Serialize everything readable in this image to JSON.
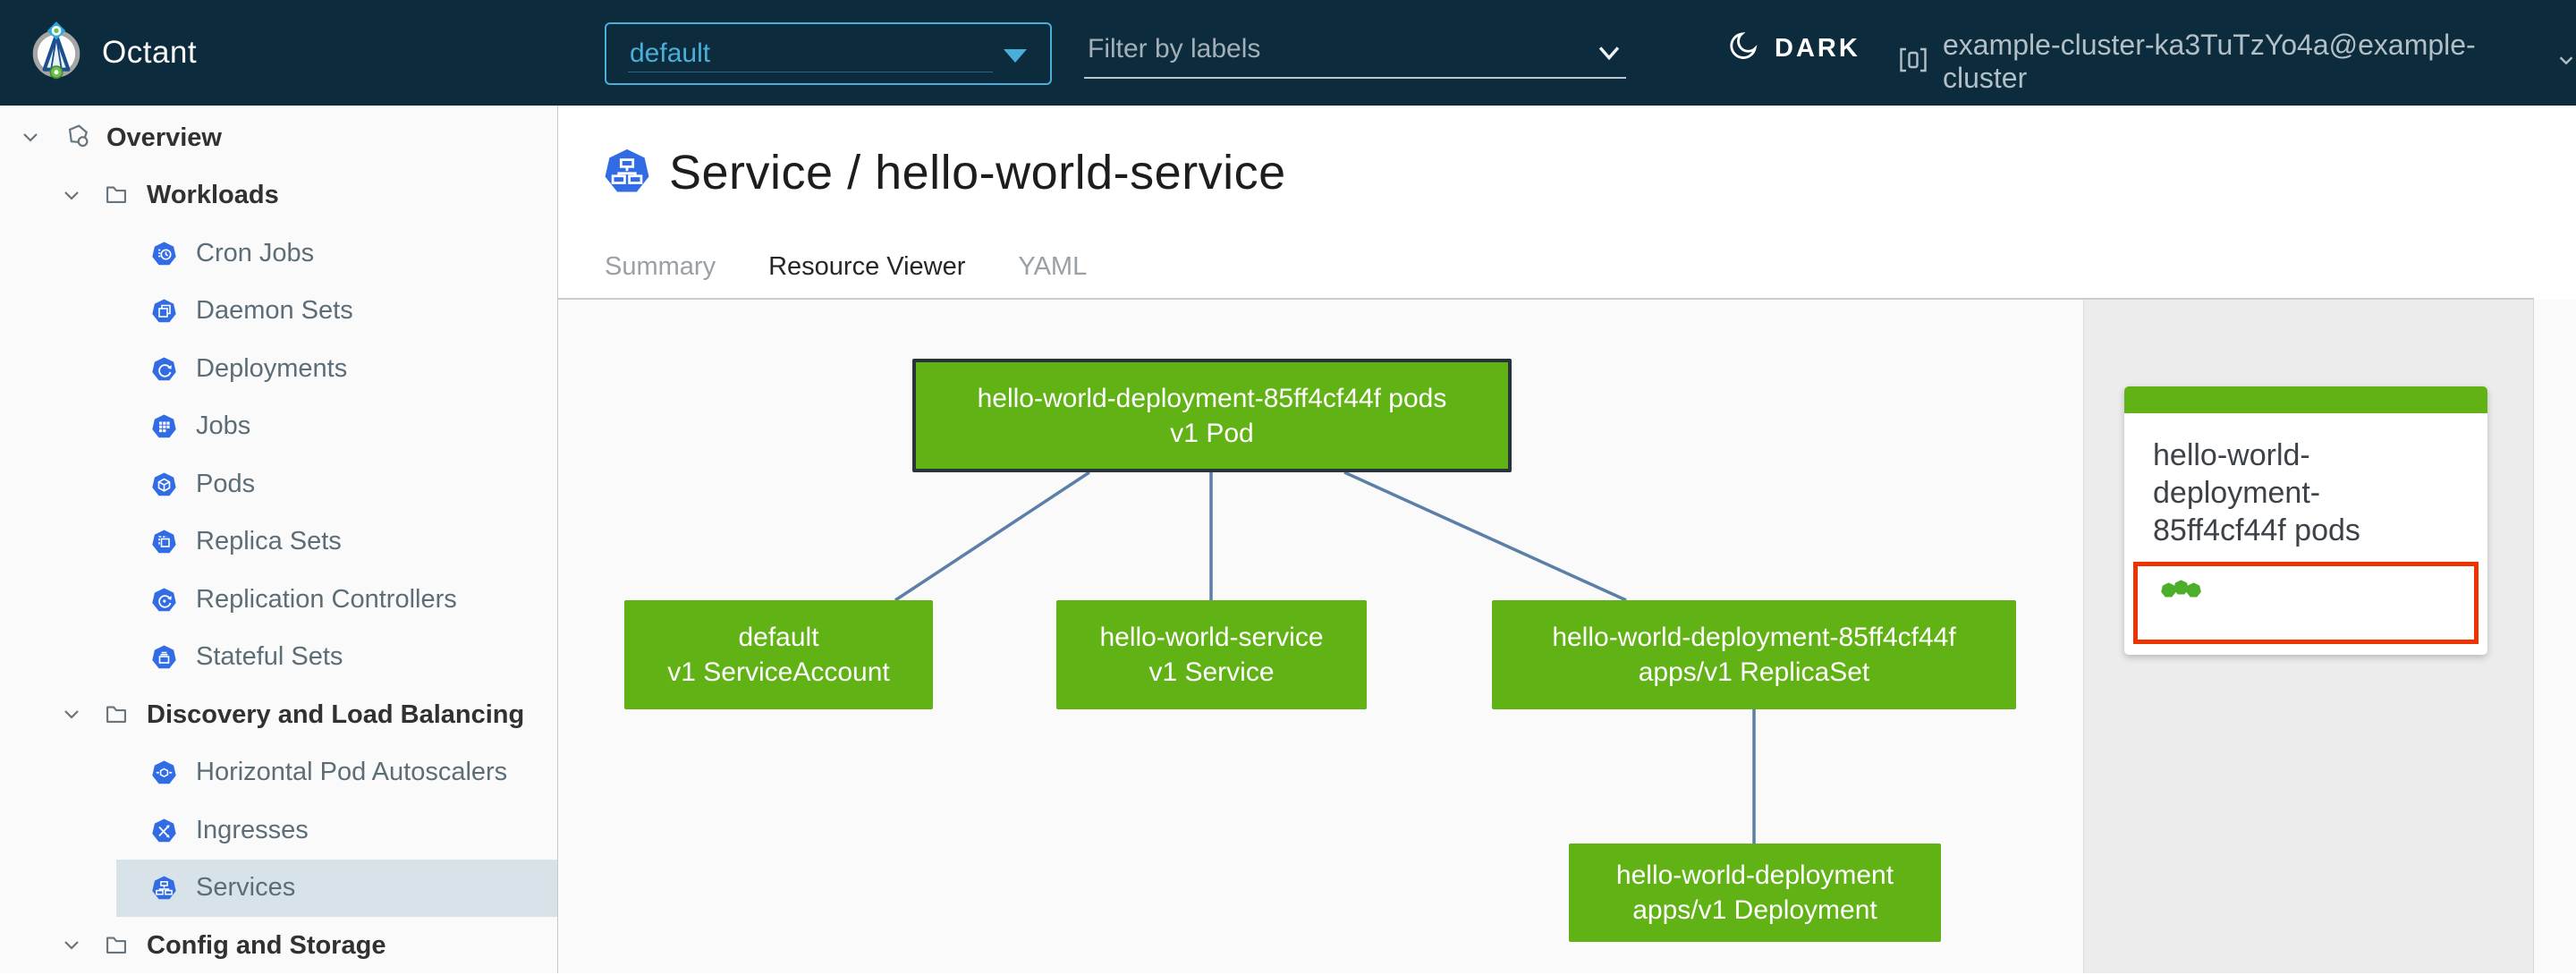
{
  "header": {
    "brand": "Octant",
    "namespace_select": {
      "value": "default"
    },
    "filter": {
      "placeholder": "Filter by labels"
    },
    "theme_toggle": {
      "label": "DARK"
    },
    "cluster": {
      "label": "example-cluster-ka3TuTzYo4a@example-cluster"
    }
  },
  "sidebar": {
    "items": [
      {
        "label": "Overview"
      },
      {
        "label": "Workloads"
      },
      {
        "label": "Cron Jobs"
      },
      {
        "label": "Daemon Sets"
      },
      {
        "label": "Deployments"
      },
      {
        "label": "Jobs"
      },
      {
        "label": "Pods"
      },
      {
        "label": "Replica Sets"
      },
      {
        "label": "Replication Controllers"
      },
      {
        "label": "Stateful Sets"
      },
      {
        "label": "Discovery and Load Balancing"
      },
      {
        "label": "Horizontal Pod Autoscalers"
      },
      {
        "label": "Ingresses"
      },
      {
        "label": "Services",
        "selected": true
      },
      {
        "label": "Config and Storage"
      }
    ]
  },
  "page": {
    "title": "Service / hello-world-service",
    "tabs": [
      {
        "label": "Summary"
      },
      {
        "label": "Resource Viewer",
        "active": true
      },
      {
        "label": "YAML"
      }
    ]
  },
  "graph": {
    "nodes": [
      {
        "id": "pod",
        "name": "hello-world-deployment-85ff4cf44f pods",
        "kind": "v1 Pod",
        "selected": true
      },
      {
        "id": "serviceaccount",
        "name": "default",
        "kind": "v1 ServiceAccount"
      },
      {
        "id": "service",
        "name": "hello-world-service",
        "kind": "v1 Service"
      },
      {
        "id": "replicaset",
        "name": "hello-world-deployment-85ff4cf44f",
        "kind": "apps/v1 ReplicaSet"
      },
      {
        "id": "deployment",
        "name": "hello-world-deployment",
        "kind": "apps/v1 Deployment"
      }
    ]
  },
  "panel": {
    "title": "hello-world-deployment-85ff4cf44f pods",
    "status": {
      "ok_count": 3
    }
  },
  "colors": {
    "header": "#0c2c3d",
    "accentblue": "#49afd9",
    "k8sblue": "#326ce5",
    "green": "#61b215",
    "edge": "#5b7fa6",
    "red": "#ee3300",
    "selected": "#d8e3e9",
    "tabactive": "#0a72a8",
    "dotgreen": "#4caf2a",
    "panelbg": "#ececec"
  }
}
